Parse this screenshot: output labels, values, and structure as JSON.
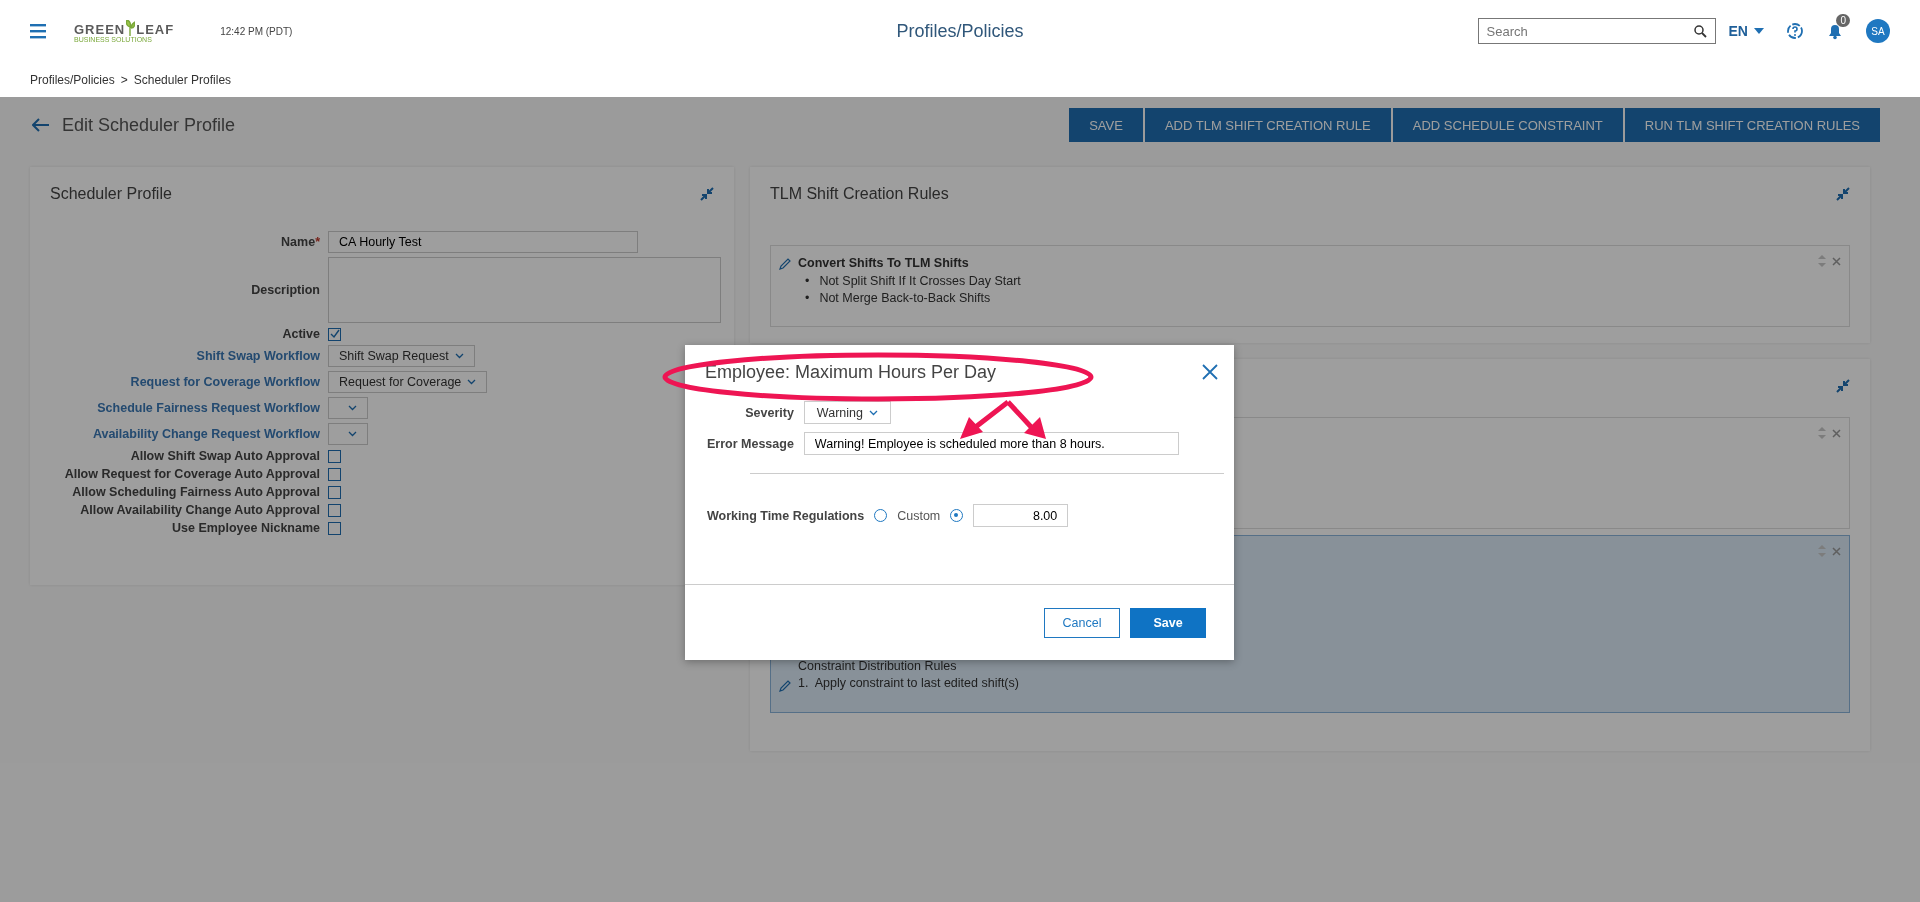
{
  "header": {
    "logo": {
      "word1": "GREEN",
      "word2": "LEAF",
      "tagline": "BUSINESS SOLUTIONS"
    },
    "time": "12:42 PM (PDT)",
    "title": "Profiles/Policies",
    "search": {
      "placeholder": "Search"
    },
    "language": "EN",
    "notifications": "0",
    "avatar": "SA"
  },
  "breadcrumb": {
    "items": [
      "Profiles/Policies",
      "Scheduler Profiles"
    ],
    "separator": ">"
  },
  "page_title": "Edit Scheduler Profile",
  "actions": [
    "SAVE",
    "ADD TLM SHIFT CREATION RULE",
    "ADD SCHEDULE CONSTRAINT",
    "RUN TLM SHIFT CREATION RULES"
  ],
  "profile_card": {
    "title": "Scheduler Profile",
    "fields": [
      {
        "kind": "text",
        "label": "Name",
        "required_mark": "*",
        "link": false,
        "value": "CA Hourly Test"
      },
      {
        "kind": "textarea",
        "label": "Description",
        "link": false
      },
      {
        "kind": "checkbox",
        "label": "Active",
        "link": false,
        "checked": true
      },
      {
        "kind": "select",
        "label": "Shift Swap Workflow",
        "link": true,
        "value": "Shift Swap Request"
      },
      {
        "kind": "select",
        "label": "Request for Coverage Workflow",
        "link": true,
        "value": "Request for Coverage"
      },
      {
        "kind": "select",
        "label": "Schedule Fairness Request Workflow",
        "link": true
      },
      {
        "kind": "select",
        "label": "Availability Change Request Workflow",
        "link": true
      },
      {
        "kind": "checkbox",
        "label": "Allow Shift Swap Auto Approval",
        "link": false,
        "checked": false
      },
      {
        "kind": "checkbox",
        "label": "Allow Request for Coverage Auto Approval",
        "link": false,
        "checked": false
      },
      {
        "kind": "checkbox",
        "label": "Allow Scheduling Fairness Auto Approval",
        "link": false,
        "checked": false
      },
      {
        "kind": "checkbox",
        "label": "Allow Availability Change Auto Approval",
        "link": false,
        "checked": false
      },
      {
        "kind": "checkbox",
        "label": "Use Employee Nickname",
        "link": false,
        "checked": false
      }
    ]
  },
  "rules_card": {
    "title": "TLM Shift Creation Rules",
    "rules": [
      {
        "title": "Convert Shifts To TLM Shifts",
        "marker": "•",
        "bullets": [
          "Not Split Shift If It Crosses Day Start",
          "Not Merge Back-to-Back Shifts"
        ]
      }
    ]
  },
  "constraints_card": {
    "items": [
      {
        "selected": false
      },
      {
        "selected": true,
        "heading": "Constraint Distribution Rules",
        "lines": [
          "1.  Apply constraint to last edited shift(s)"
        ]
      }
    ]
  },
  "modal": {
    "title": "Employee: Maximum Hours Per Day",
    "severity": {
      "label": "Severity",
      "value": "Warning"
    },
    "error_message": {
      "label": "Error Message",
      "value": "Warning! Employee is scheduled more than 8 hours."
    },
    "regulations": {
      "label": "Working Time Regulations",
      "controls": [
        {
          "kind": "radio",
          "selected": false
        },
        {
          "kind": "label",
          "text": "Custom"
        },
        {
          "kind": "radio",
          "selected": true
        },
        {
          "kind": "input",
          "value": "8.00"
        }
      ]
    },
    "buttons": [
      {
        "kind": "secondary",
        "label": "Cancel"
      },
      {
        "kind": "primary",
        "label": "Save"
      }
    ]
  }
}
